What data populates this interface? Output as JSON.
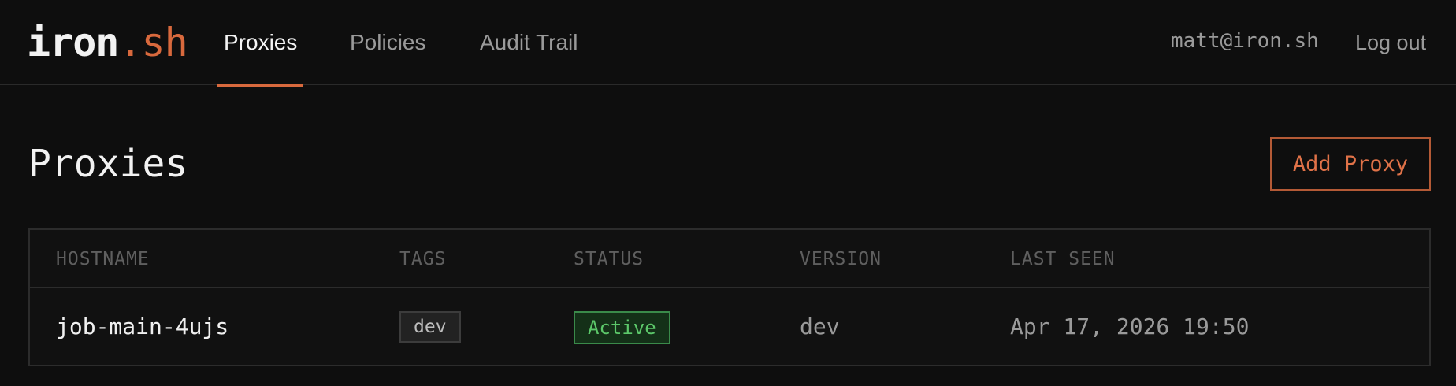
{
  "brand": {
    "name": "iron",
    "suffix": ".sh",
    "accent_color": "#d8693d"
  },
  "nav": {
    "tabs": [
      {
        "label": "Proxies",
        "active": true
      },
      {
        "label": "Policies",
        "active": false
      },
      {
        "label": "Audit Trail",
        "active": false
      }
    ]
  },
  "user": {
    "email": "matt@iron.sh",
    "logout_label": "Log out"
  },
  "page": {
    "title": "Proxies",
    "add_button_label": "Add Proxy"
  },
  "table": {
    "columns": [
      "HOSTNAME",
      "TAGS",
      "STATUS",
      "VERSION",
      "LAST SEEN"
    ],
    "rows": [
      {
        "hostname": "job-main-4ujs",
        "tags": [
          "dev"
        ],
        "status": "Active",
        "status_color": "#5cc86a",
        "version": "dev",
        "last_seen": "Apr 17, 2026 19:50"
      }
    ]
  }
}
